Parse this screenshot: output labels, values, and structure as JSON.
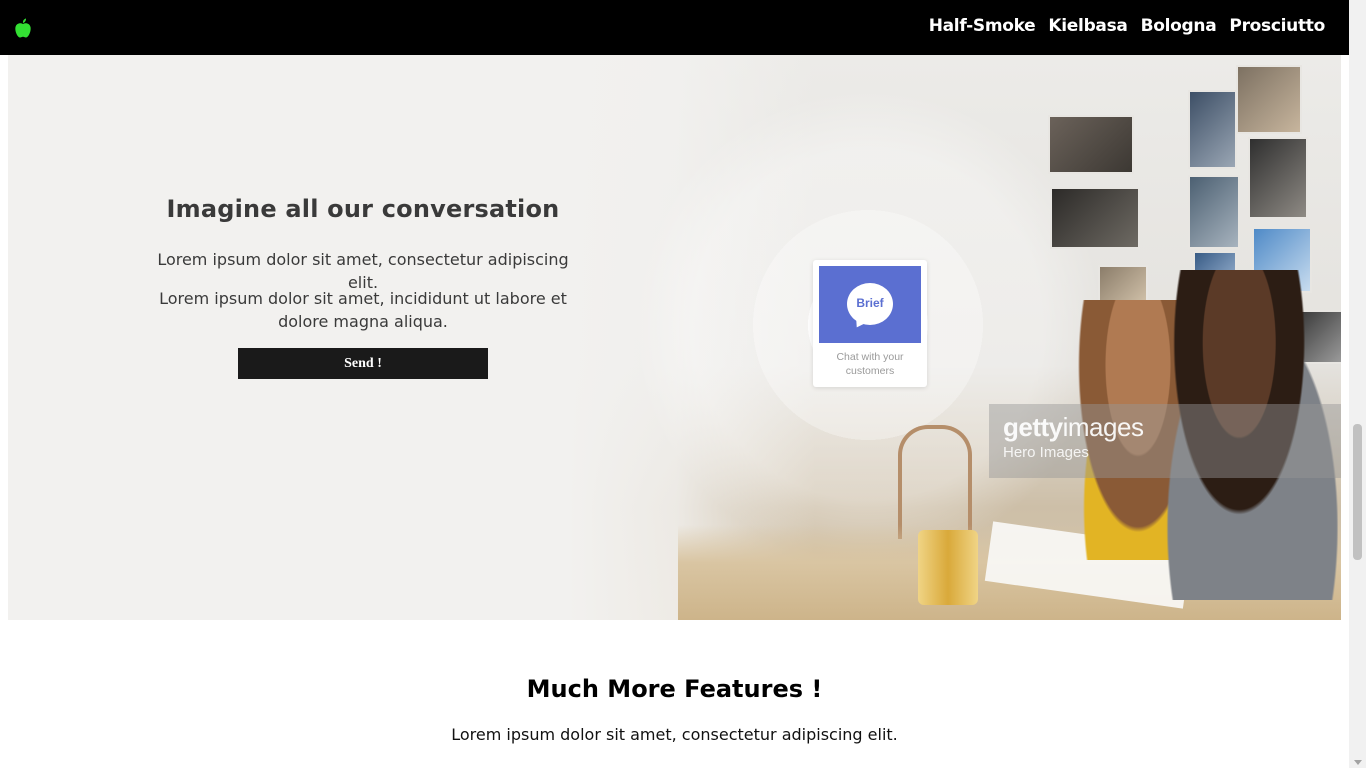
{
  "navbar": {
    "logo_icon": "apple-icon",
    "logo_color": "#33e033",
    "links": [
      "Half-Smoke",
      "Kielbasa",
      "Bologna",
      "Prosciutto"
    ]
  },
  "hero": {
    "title": "Imagine all our conversation",
    "paragraph_1": "Lorem ipsum dolor sit amet, consectetur adipiscing elit.",
    "paragraph_2": "Lorem ipsum dolor sit amet, incididunt ut labore et dolore magna aliqua.",
    "button_label": "Send !",
    "chat_card": {
      "bubble_text": "Brief",
      "caption": "Chat with your customers"
    },
    "watermark": {
      "brand_bold": "getty",
      "brand_rest": "images",
      "subtitle": "Hero Images"
    }
  },
  "features": {
    "title": "Much More Features !",
    "paragraph": "Lorem ipsum dolor sit amet, consectetur adipiscing elit."
  },
  "colors": {
    "navbar_bg": "#000000",
    "hero_bg": "#f2f1ef",
    "button_bg": "#1a1a1a",
    "chat_accent": "#5b6fd1"
  }
}
